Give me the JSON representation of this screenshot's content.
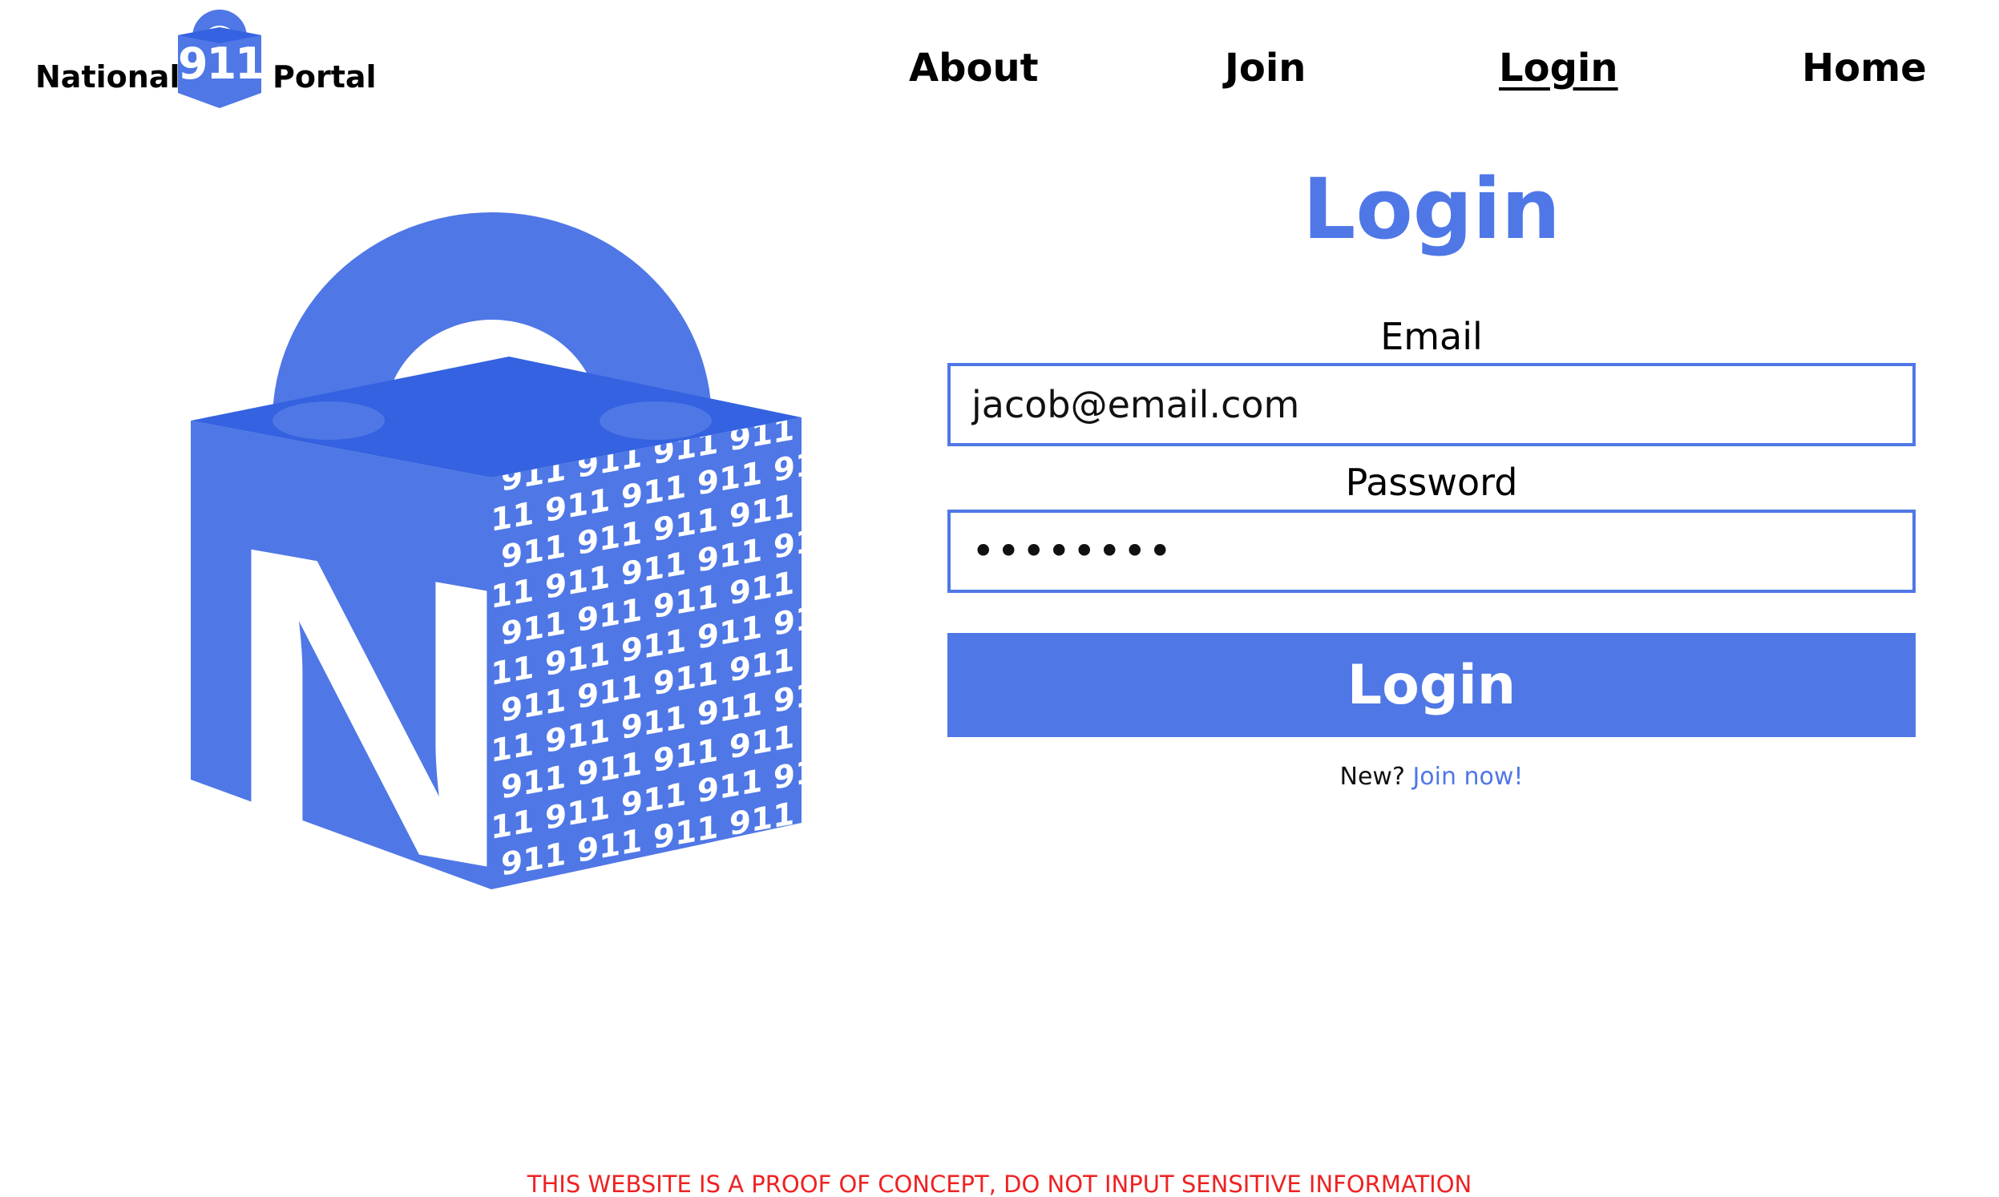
{
  "brand": {
    "word_left": "National",
    "logo_text": "911",
    "word_right": "Portal"
  },
  "nav": {
    "items": [
      {
        "label": "About"
      },
      {
        "label": "Join"
      },
      {
        "label": "Login",
        "active": true
      },
      {
        "label": "Home"
      }
    ]
  },
  "hero": {
    "letter": "N",
    "pattern_text": "911",
    "accent_color": "#4f77e6",
    "top_color": "#3462e0"
  },
  "form": {
    "title": "Login",
    "email_label": "Email",
    "email_value": "jacob@email.com",
    "password_label": "Password",
    "password_value": "••••••••",
    "submit_label": "Login",
    "signup_prompt": "New?",
    "signup_link": "Join now!"
  },
  "footer": {
    "disclaimer": "THIS WEBSITE IS A PROOF OF CONCEPT, DO NOT INPUT SENSITIVE INFORMATION",
    "disclaimer_color": "#ee2222"
  }
}
